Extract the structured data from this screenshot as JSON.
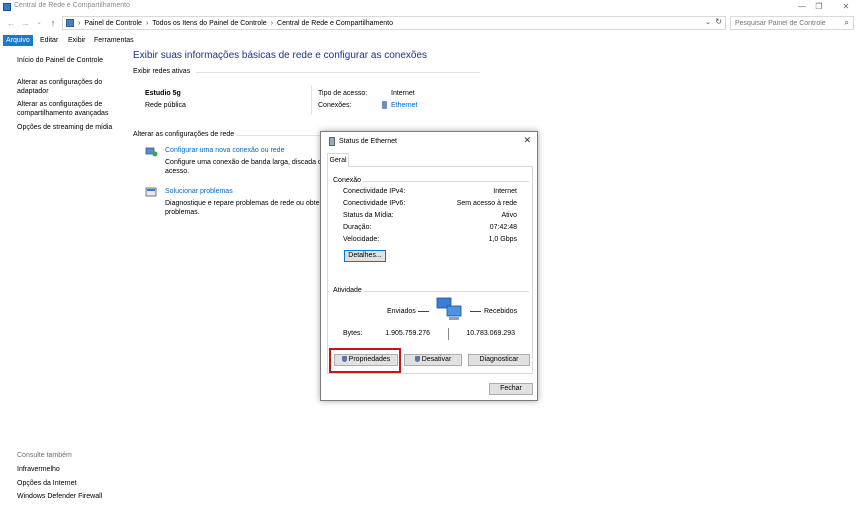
{
  "window": {
    "title": "Central de Rede e Compartilhamento",
    "min_glyph": "—",
    "max_glyph": "❐",
    "close_glyph": "✕"
  },
  "nav": {
    "back_glyph": "←",
    "forward_glyph": "→",
    "recent_glyph": "⌄",
    "up_glyph": "↑"
  },
  "address": {
    "crumbs": [
      "Painel de Controle",
      "Todos os Itens do Painel de Controle",
      "Central de Rede e Compartilhamento"
    ],
    "sep_glyph": "›",
    "dropdown_glyph": "⌄",
    "refresh_glyph": "↻"
  },
  "search": {
    "placeholder": "Pesquisar Painel de Controle",
    "icon": "search-icon",
    "glyph": "⌕"
  },
  "menu": [
    "Arquivo",
    "Editar",
    "Exibir",
    "Ferramentas"
  ],
  "left_pane": {
    "home": "Início do Painel de Controle",
    "adapter": [
      "Alterar as configurações do",
      "adaptador"
    ],
    "sharing": [
      "Alterar as configurações de",
      "compartilhamento avançadas"
    ],
    "streaming": "Opções de streaming de mídia",
    "see_also_title": "Consulte também",
    "see_also": [
      "Infravermelho",
      "Opções da Internet",
      "Windows Defender Firewall"
    ]
  },
  "main": {
    "title": "Exibir suas informações básicas de rede e configurar as conexões",
    "active_networks_label": "Exibir redes ativas",
    "network_name": "Estudio 5g",
    "network_type": "Rede pública",
    "access_type_label": "Tipo de acesso:",
    "access_type_value": "Internet",
    "connections_label": "Conexões:",
    "connections_value": "Ethernet",
    "change_settings_label": "Alterar as configurações de rede",
    "task1_title": "Configurar uma nova conexão ou rede",
    "task1_desc": [
      "Configure uma conexão de banda larga, discada o",
      "acesso."
    ],
    "task2_title": "Solucionar problemas",
    "task2_desc": [
      "Diagnostique e repare problemas de rede ou obte",
      "problemas."
    ]
  },
  "dialog": {
    "title": "Status de Ethernet",
    "close_glyph": "✕",
    "tab": "Geral",
    "connection_group": "Conexão",
    "rows": [
      {
        "label": "Conectividade IPv4:",
        "value": "Internet"
      },
      {
        "label": "Conectividade IPv6:",
        "value": "Sem acesso à rede"
      },
      {
        "label": "Status da Mídia:",
        "value": "Ativo"
      },
      {
        "label": "Duração:",
        "value": "07:42:48"
      },
      {
        "label": "Velocidade:",
        "value": "1,0 Gbps"
      }
    ],
    "details_button": "Detalhes...",
    "activity_group": "Atividade",
    "sent_label": "Enviados",
    "received_label": "Recebidos",
    "bytes_label": "Bytes:",
    "bytes_sent": "1.905.759.276",
    "bytes_received": "10.783.069.293",
    "properties_button": "Propriedades",
    "disable_button": "Desativar",
    "diagnose_button": "Diagnosticar",
    "close_button": "Fechar"
  },
  "colors": {
    "accent": "#1979ca",
    "title_blue": "#1e3287",
    "link": "#0066cc",
    "highlight": "#c8141c"
  }
}
